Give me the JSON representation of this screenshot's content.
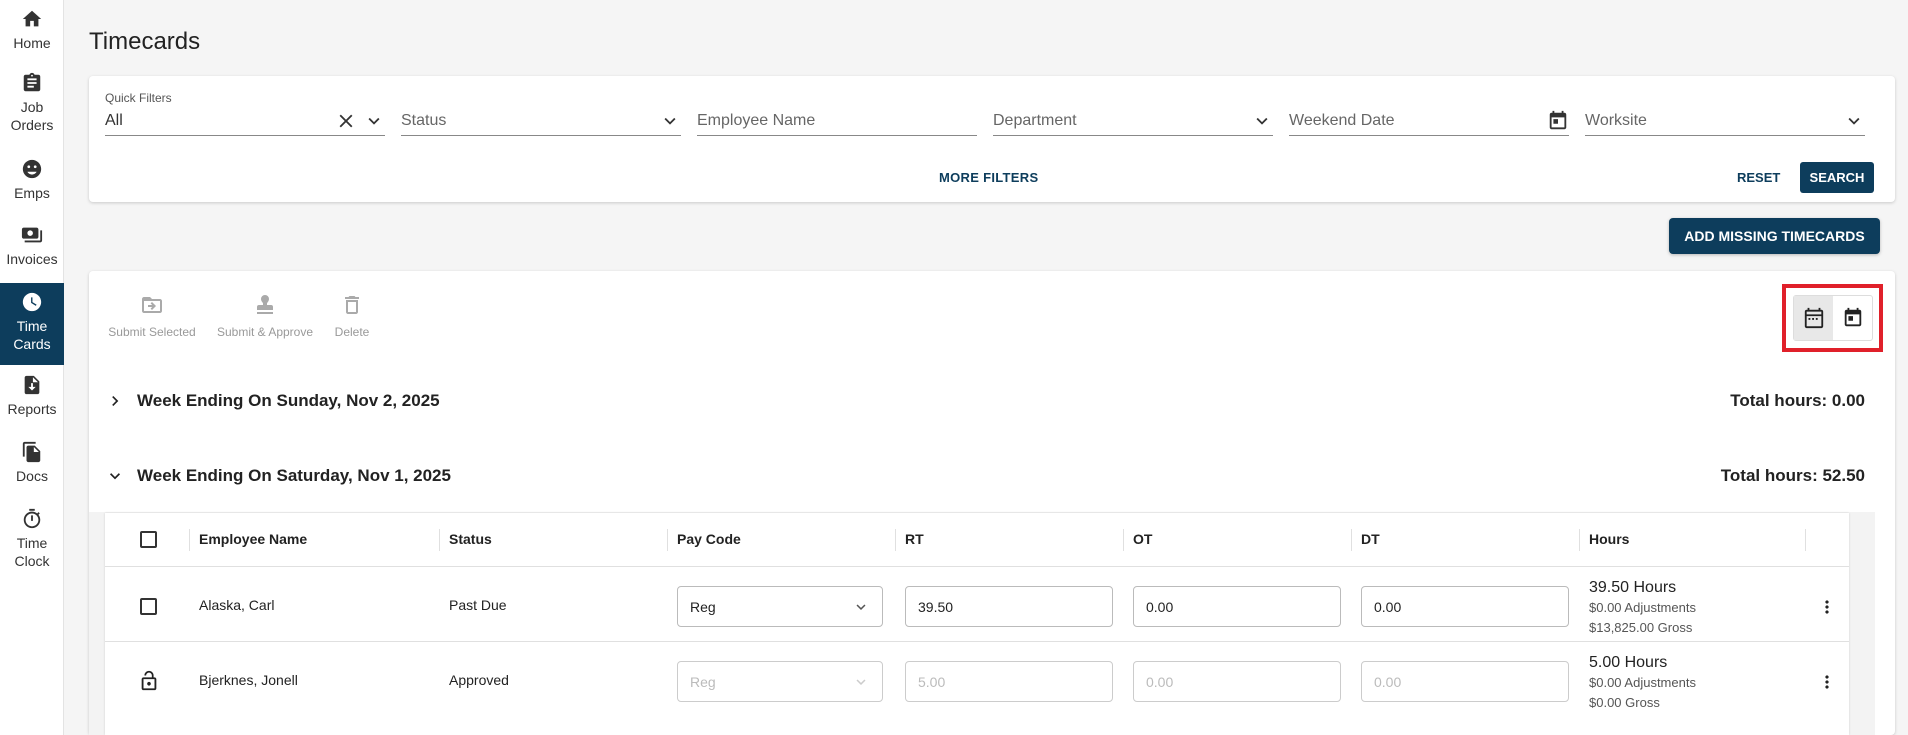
{
  "sidebar": {
    "items": [
      {
        "label": "Home",
        "icon": "home-icon"
      },
      {
        "label": "Job Orders",
        "icon": "clipboard-icon"
      },
      {
        "label": "Emps",
        "icon": "people-icon"
      },
      {
        "label": "Invoices",
        "icon": "money-icon"
      },
      {
        "label": "Time Cards",
        "icon": "clock-icon",
        "active": true
      },
      {
        "label": "Reports",
        "icon": "report-icon"
      },
      {
        "label": "Docs",
        "icon": "docs-icon"
      },
      {
        "label": "Time Clock",
        "icon": "stopwatch-icon"
      }
    ]
  },
  "page": {
    "title": "Timecards"
  },
  "filters": {
    "quick_filters_label": "Quick Filters",
    "quick_filters_value": "All",
    "status_placeholder": "Status",
    "employee_name_placeholder": "Employee Name",
    "department_placeholder": "Department",
    "weekend_date_placeholder": "Weekend Date",
    "worksite_placeholder": "Worksite",
    "more_filters": "MORE FILTERS",
    "reset": "RESET",
    "search": "SEARCH"
  },
  "add_missing_label": "ADD MISSING TIMECARDS",
  "actions": {
    "submit_selected": "Submit Selected",
    "submit_approve": "Submit & Approve",
    "delete": "Delete"
  },
  "weeks": [
    {
      "title": "Week Ending On Sunday, Nov 2, 2025",
      "total": "Total hours: 0.00",
      "expanded": false
    },
    {
      "title": "Week Ending On Saturday, Nov 1, 2025",
      "total": "Total hours: 52.50",
      "expanded": true
    }
  ],
  "table": {
    "headers": [
      "Employee Name",
      "Status",
      "Pay Code",
      "RT",
      "OT",
      "DT",
      "Hours"
    ],
    "rows": [
      {
        "name": "Alaska, Carl",
        "status": "Past Due",
        "pay_code": "Reg",
        "rt": "39.50",
        "ot": "0.00",
        "dt": "0.00",
        "hours": "39.50 Hours",
        "adjustments": "$0.00 Adjustments",
        "gross": "$13,825.00 Gross",
        "locked": false
      },
      {
        "name": "Bjerknes, Jonell",
        "status": "Approved",
        "pay_code": "Reg",
        "rt": "5.00",
        "ot": "0.00",
        "dt": "0.00",
        "hours": "5.00 Hours",
        "adjustments": "$0.00 Adjustments",
        "gross": "$0.00 Gross",
        "locked": true
      }
    ]
  },
  "colors": {
    "primary": "#0d3d5c",
    "highlight": "#e0202a"
  }
}
